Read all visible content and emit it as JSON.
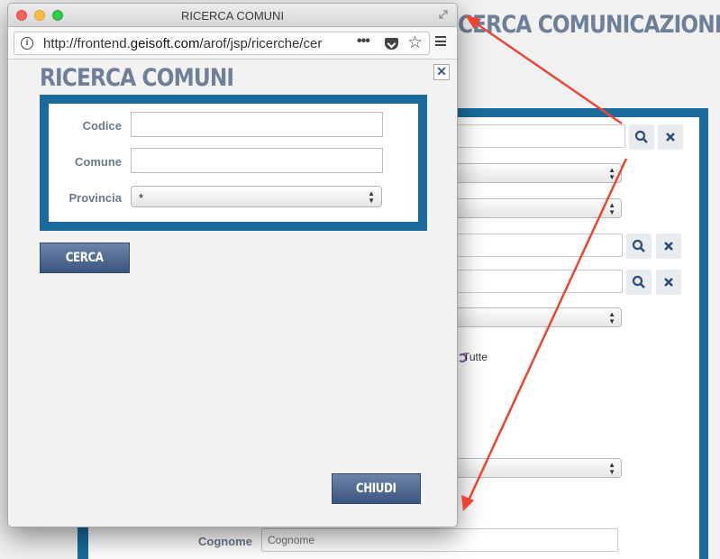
{
  "background_page": {
    "title": "CERCA COMUNICAZIONI",
    "radio_label": "Tutte",
    "cognome_label": "Cognome",
    "cognome_placeholder": "Cognome",
    "search_icon": "search-icon",
    "clear_icon": "close-icon"
  },
  "popup": {
    "window_title": "RICERCA COMUNI",
    "url": {
      "prefix": "http://frontend.",
      "domain": "geisoft.com",
      "path": "/arof/jsp/ricerche/cer"
    },
    "form_title": "RICERCA COMUNI",
    "fields": {
      "codice_label": "Codice",
      "codice_value": "",
      "comune_label": "Comune",
      "comune_value": "",
      "provincia_label": "Provincia",
      "provincia_value": "*"
    },
    "cerca_label": "CERCA",
    "chiudi_label": "CHIUDI",
    "close_glyph": "✕"
  },
  "colors": {
    "frame_blue": "#1a6b9c",
    "title_slate": "#6d7f99",
    "button_navy": "#3a557f",
    "arrow_red": "#ee4433"
  }
}
